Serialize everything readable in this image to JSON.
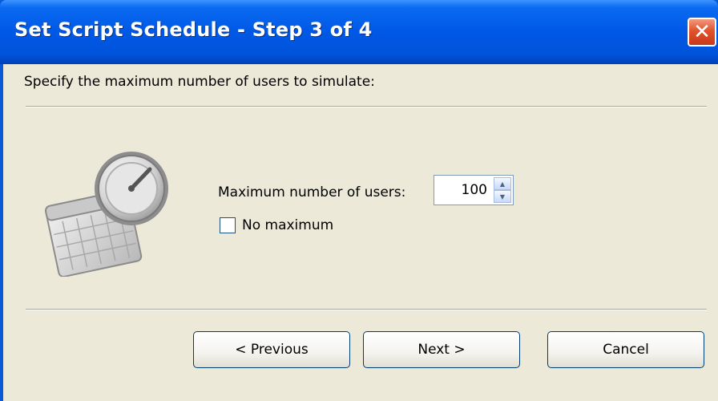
{
  "window": {
    "title": "Set Script Schedule - Step 3 of 4",
    "close_glyph": "✕"
  },
  "instruction": "Specify the maximum number of users to simulate:",
  "max_users": {
    "label": "Maximum number of users:",
    "value": "100"
  },
  "no_maximum": {
    "label": "No maximum",
    "checked": false
  },
  "buttons": {
    "previous": "< Previous",
    "next": "Next >",
    "cancel": "Cancel"
  },
  "icons": {
    "app": "schedule-clock-calendar-icon",
    "close": "close-icon",
    "spin_up": "spin-up-icon",
    "spin_down": "spin-down-icon"
  },
  "colors": {
    "titlebar": "#0058e6",
    "client_bg": "#ece9d8",
    "close_button": "#e0532c",
    "button_border": "#003c74"
  }
}
